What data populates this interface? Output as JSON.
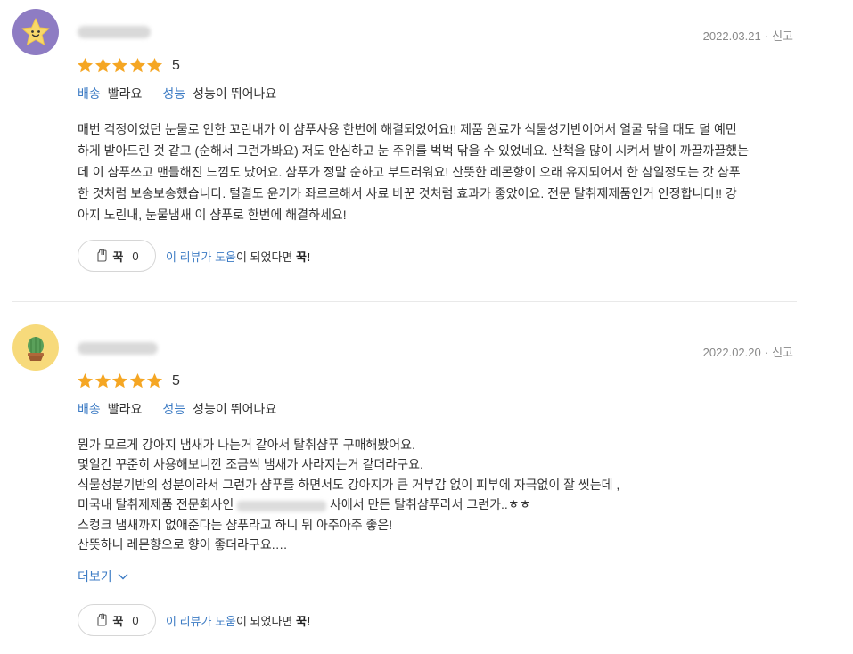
{
  "reviews": [
    {
      "avatar": "star-face-icon",
      "date": "2022.03.21",
      "report": "신고",
      "rating": 5,
      "rating_label": "5",
      "attributes": [
        {
          "key": "배송",
          "value": "빨라요"
        },
        {
          "key": "성능",
          "value": "성능이 뛰어나요"
        }
      ],
      "lines": [
        "매번 걱정이었던 눈물로 인한 꼬린내가 이 샴푸사용 한번에 해결되었어요!! 제품 원료가 식물성기반이어서 얼굴 닦을 때도 덜 예민",
        "하게 받아드린 것 같고 (순해서 그런가봐요) 저도 안심하고 눈 주위를 벅벅 닦을 수 있었네요. 산책을 많이 시켜서 발이 까끌까끌했는",
        "데 이 샴푸쓰고 맨들해진 느낌도 났어요. 샴푸가 정말 순하고 부드러워요! 산뜻한 레몬향이 오래 유지되어서 한 삼일정도는 갓 샴푸",
        "한 것처럼 보송보송했습니다. 털결도 윤기가 좌르르해서 사료 바꾼 것처럼 효과가 좋았어요. 전문 탈취제제품인거 인정합니다!! 강",
        "아지 노린내, 눈물냄새 이 샴푸로 한번에 해결하세요!"
      ],
      "helpful": {
        "button": "꾹",
        "count": "0",
        "text_blue": "이 리뷰가 도움",
        "text_mid": "이 되었다면 ",
        "text_bold": "꾹!"
      }
    },
    {
      "avatar": "cactus-icon",
      "date": "2022.02.20",
      "report": "신고",
      "rating": 5,
      "rating_label": "5",
      "attributes": [
        {
          "key": "배송",
          "value": "빨라요"
        },
        {
          "key": "성능",
          "value": "성능이 뛰어나요"
        }
      ],
      "lines": [
        "뭔가 모르게 강아지 냄새가 나는거 같아서 탈취샴푸 구매해봤어요.",
        "몇일간 꾸준히 사용해보니깐 조금씩 냄새가 사라지는거 같더라구요.",
        "식물성분기반의 성분이라서 그런가 샴푸를 하면서도 강아지가 큰 거부감 없이 피부에 자극없이 잘 씻는데 ,",
        "미국내 탈취제제품 전문회사인",
        "스컹크 냄새까지 없애준다는 샴푸라고 하니 뭐 아주아주 좋은!",
        "산뜻하니 레몬향으로 향이 좋더라구요.…"
      ],
      "line4_suffix": " 사에서 만든 탈취샴푸라서 그런가..ㅎㅎ",
      "more": "더보기",
      "helpful": {
        "button": "꾹",
        "count": "0",
        "text_blue": "이 리뷰가 도움",
        "text_mid": "이 되었다면 ",
        "text_bold": "꾹!"
      }
    }
  ],
  "colors": {
    "accent": "#3c7bc4",
    "star": "#f5a623"
  }
}
